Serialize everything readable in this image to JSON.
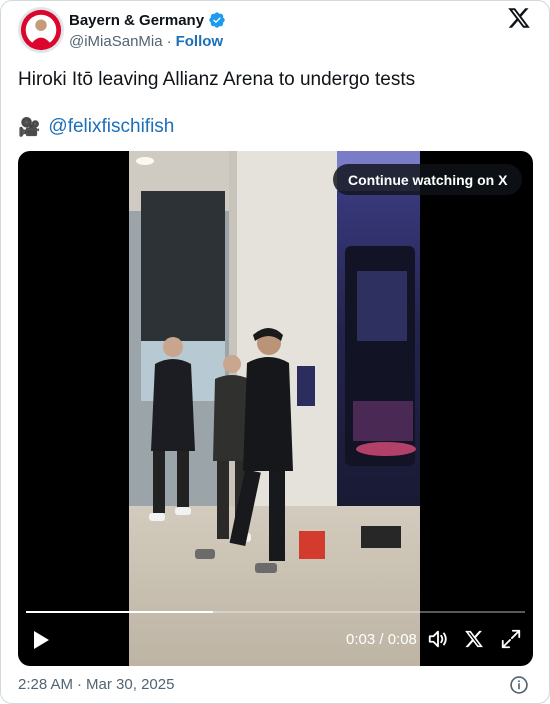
{
  "author": {
    "display_name": "Bayern & Germany",
    "handle": "@iMiaSanMia",
    "separator": "·",
    "follow_label": "Follow",
    "verified": true
  },
  "tweet": {
    "text": "Hiroki Itō leaving Allianz Arena to undergo tests",
    "credit_icon": "video-camera-icon",
    "credit_mention": "@felixfischifish"
  },
  "video": {
    "continue_label": "Continue watching on X",
    "time_display": "0:03 / 0:08",
    "progress_fraction": 0.375
  },
  "footer": {
    "time": "2:28 AM",
    "separator": "·",
    "date": "Mar 30, 2025"
  },
  "colors": {
    "link": "#1d6fb8",
    "verified_badge": "#1d9bf0",
    "muted_text": "#536471"
  }
}
